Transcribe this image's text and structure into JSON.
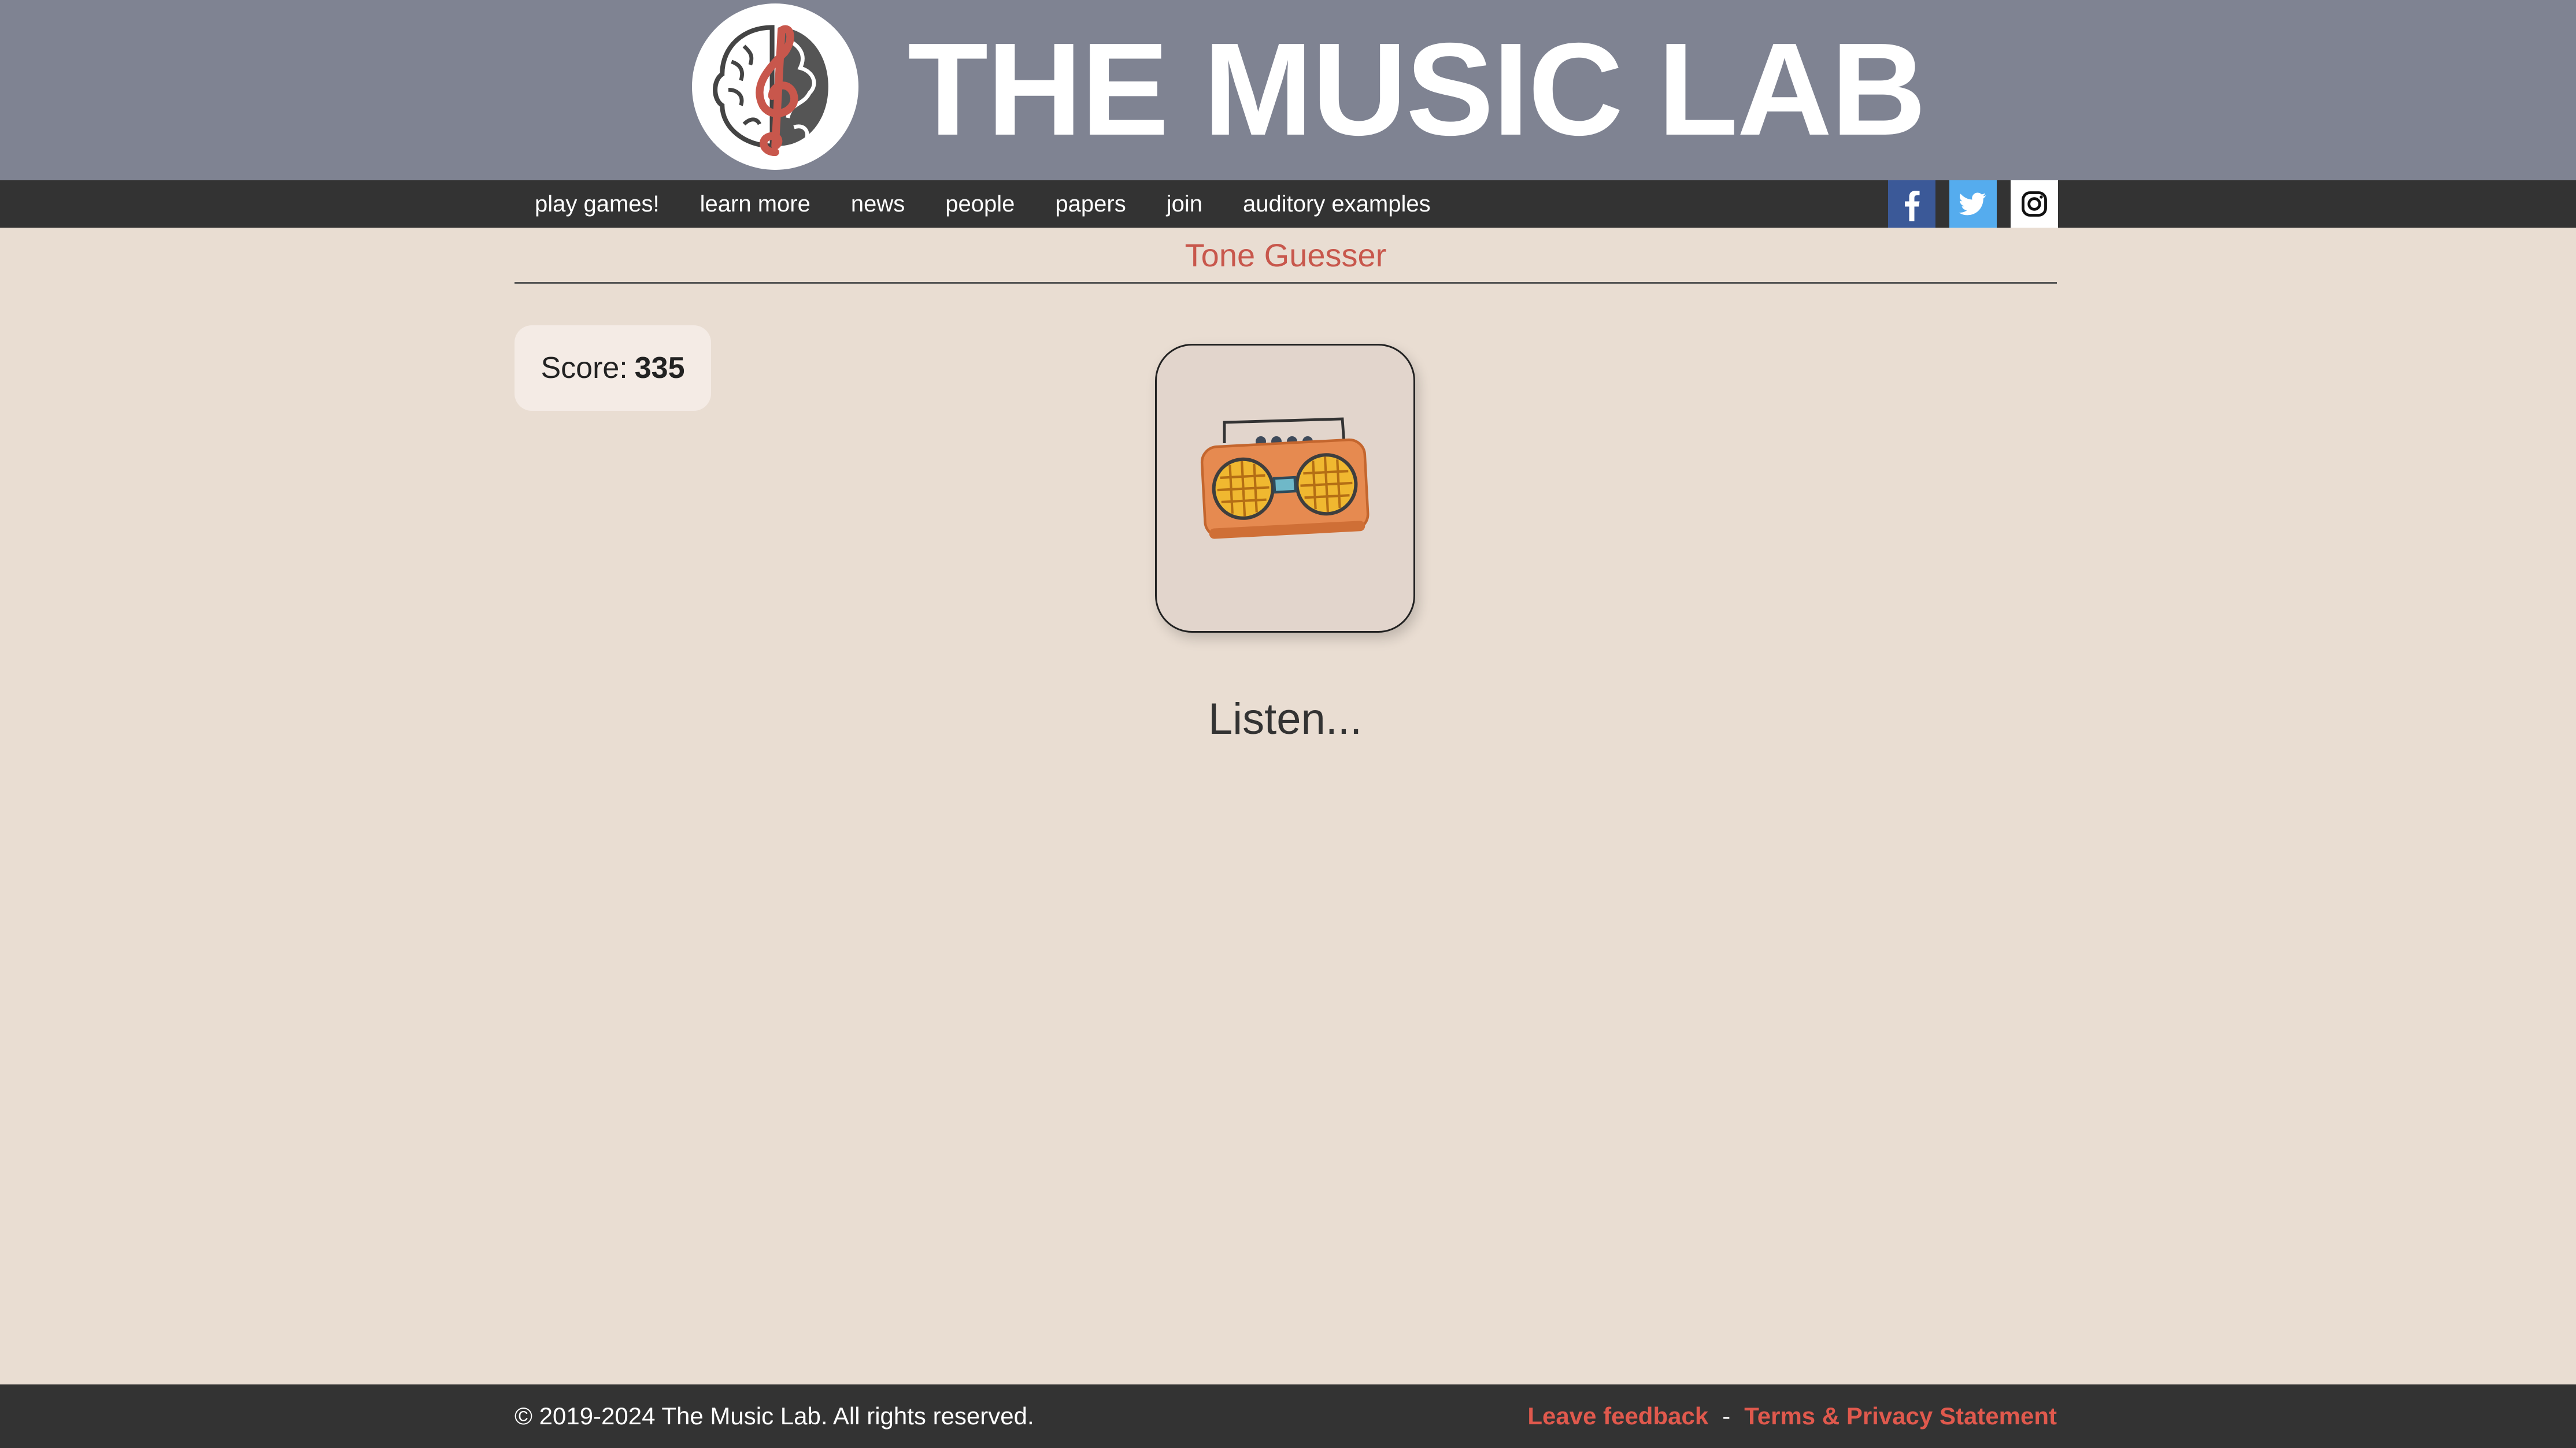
{
  "header": {
    "logo_icon": "treble-clef-brain-globe-icon",
    "site_title": "THE MUSIC LAB"
  },
  "nav": {
    "items": [
      {
        "label": "play games!"
      },
      {
        "label": "learn more"
      },
      {
        "label": "news"
      },
      {
        "label": "people"
      },
      {
        "label": "papers"
      },
      {
        "label": "join"
      },
      {
        "label": "auditory examples"
      }
    ],
    "social": [
      {
        "icon": "facebook-icon",
        "color": "#3b5998"
      },
      {
        "icon": "twitter-icon",
        "color": "#55acee"
      },
      {
        "icon": "instagram-icon",
        "color": "#ffffff"
      }
    ]
  },
  "page": {
    "title": "Tone Guesser",
    "score_label": "Score:",
    "score_value": "335",
    "radio_icon": "boombox-radio-icon",
    "status": "Listen..."
  },
  "footer": {
    "copyright": "© 2019-2024 The Music Lab. All rights reserved.",
    "feedback_label": "Leave feedback",
    "separator": "-",
    "terms_label": "Terms & Privacy Statement"
  },
  "colors": {
    "banner": "#7f8392",
    "nav": "#333333",
    "background": "#e9ddd2",
    "accent": "#c8574c",
    "link": "#e0594d"
  }
}
